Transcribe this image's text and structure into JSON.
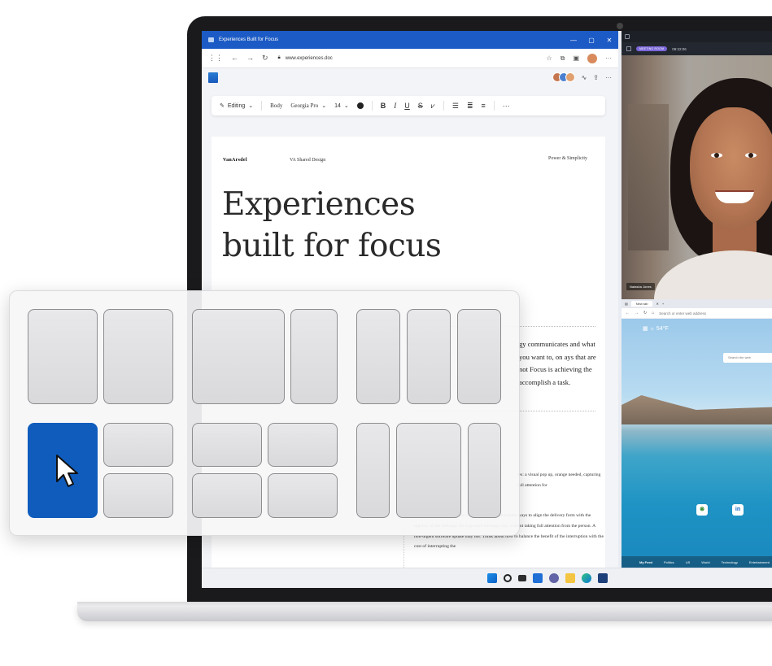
{
  "window": {
    "title": "Experiences Built for Focus",
    "url": "www.experiences.doc"
  },
  "ribbon": {
    "mode": "Editing",
    "style": "Body",
    "font": "Georgia Pro",
    "size": "14"
  },
  "document": {
    "brand": "VanArsdel",
    "shared": "VA Shared Design",
    "tagline": "Power & Simplicity",
    "headline": "Experiences built for focus",
    "para1": "gy communicates and what you want to, on ays that are not Focus is achieving the accomplish a task.",
    "para2": "tes: a visual pop up, orange needed, capturing full attention for",
    "para3": "ermine, how much attention it needs ttention. Determine ways to align the delivery form with the urgency of the message. As important message may warrant taking full attention from the person. A non-urgent software update may not. Think about how to balance the benefit of the interruption with the cost of interrupting the"
  },
  "video_call": {
    "badge": "MEETING ROOM",
    "time": "09:22:06",
    "participant": "Natasha Jones"
  },
  "browser": {
    "tab": "New tab",
    "address_placeholder": "Search or enter web address",
    "weather": "54°F",
    "search_placeholder": "Search the web",
    "feed": [
      "My Feed",
      "Politics",
      "US",
      "World",
      "Technology",
      "Entertainment"
    ]
  },
  "taskbar": {
    "icons": [
      "windows-start-icon",
      "search-icon",
      "task-view-icon",
      "widgets-icon",
      "teams-chat-icon",
      "file-explorer-icon",
      "edge-icon",
      "store-icon"
    ]
  },
  "snap_layouts": {
    "accent": "#0f5cbc",
    "selected": "quad-left-main"
  },
  "colors": {
    "titlebar": "#1c5bc5",
    "accent": "#0f5cbc"
  }
}
